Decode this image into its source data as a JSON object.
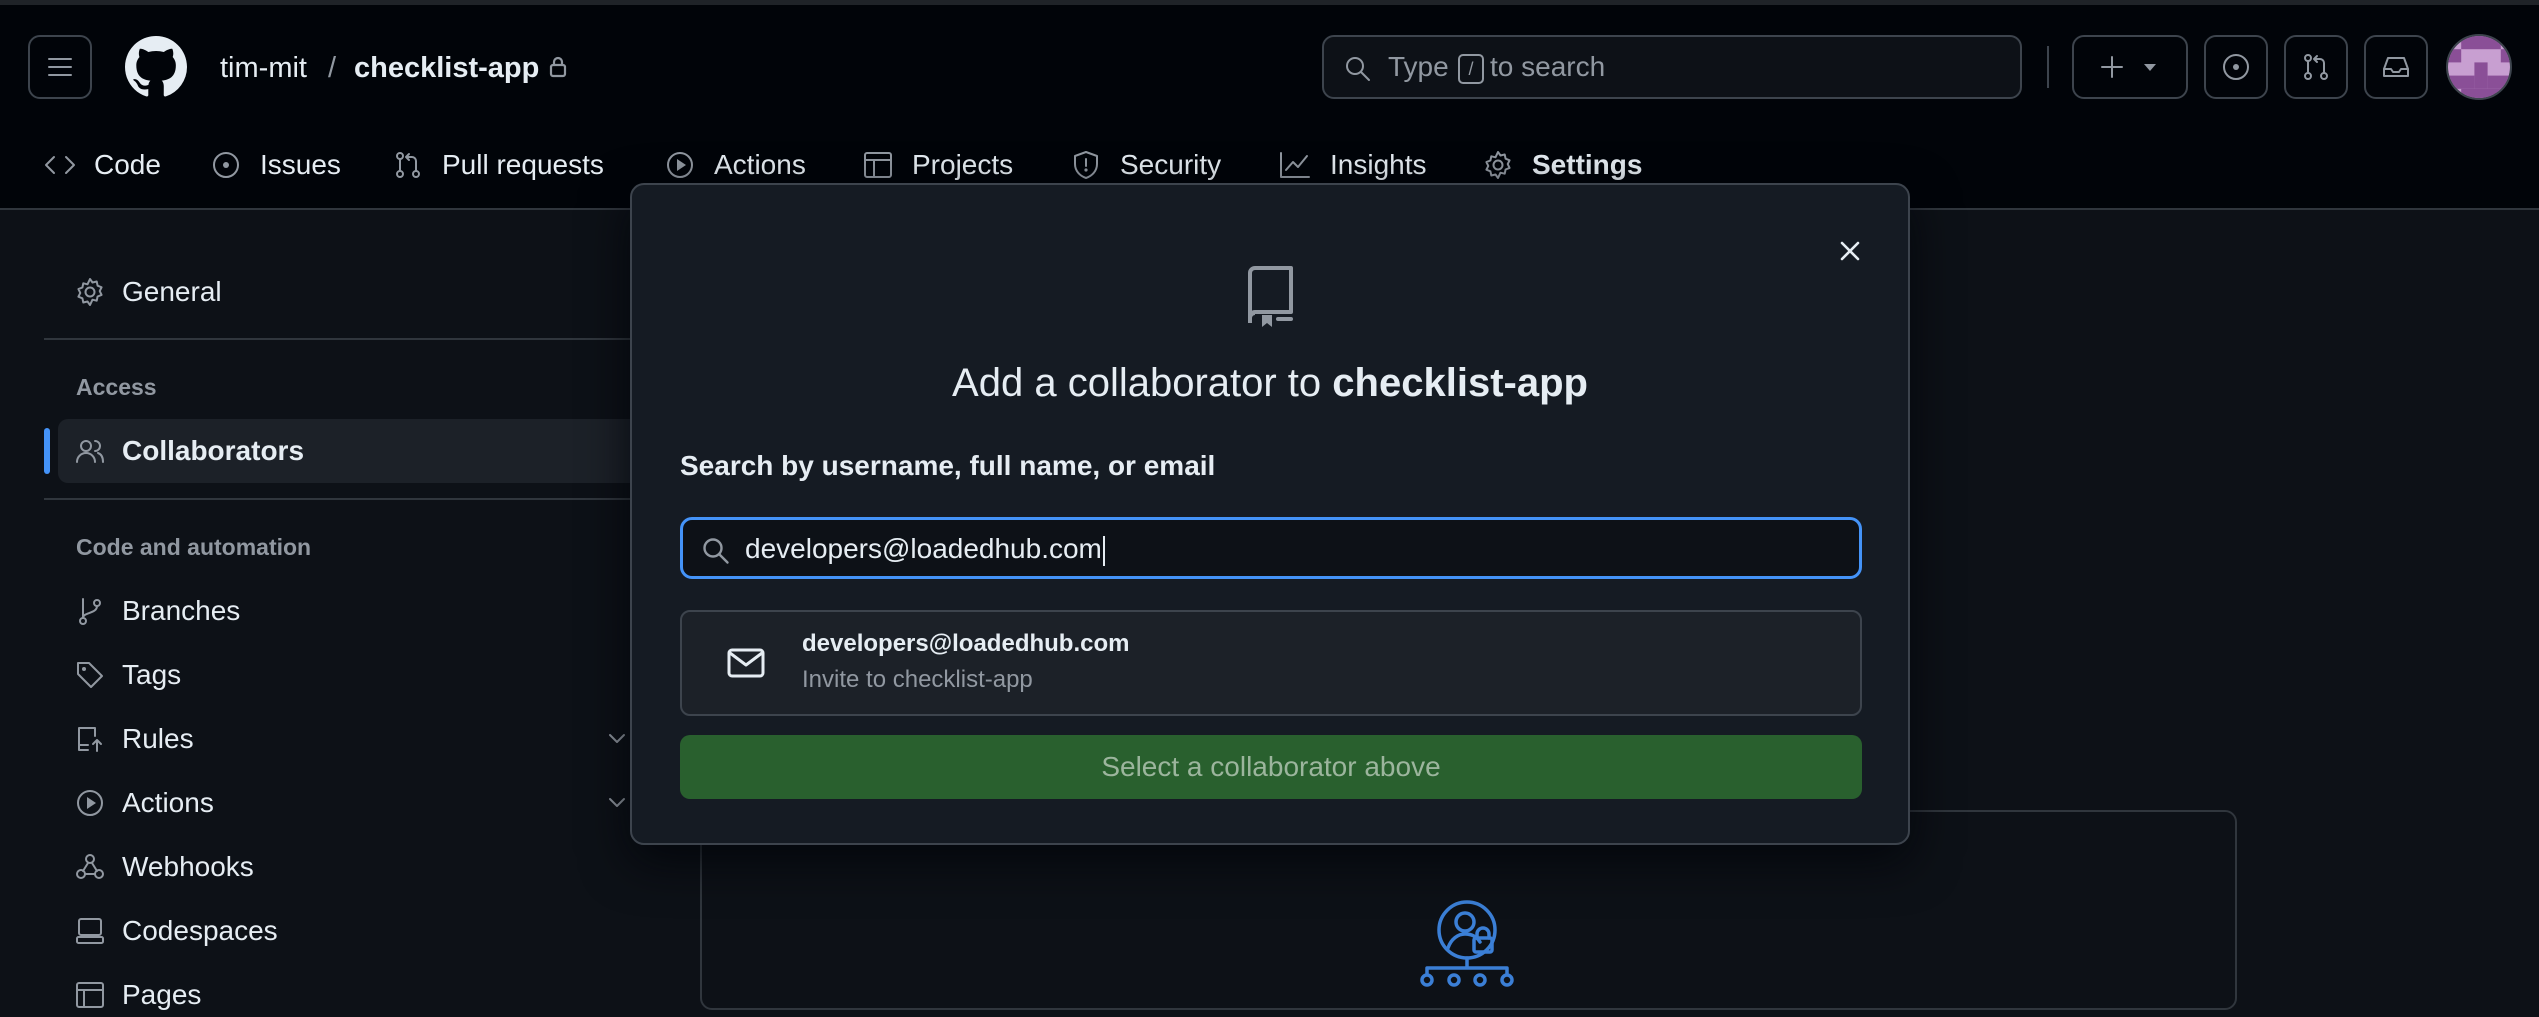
{
  "header": {
    "owner": "tim-mit",
    "separator": "/",
    "repo": "checklist-app",
    "search": {
      "prefix": "Type",
      "key": "/",
      "suffix": "to search"
    }
  },
  "repo_nav": {
    "items": [
      {
        "label": "Code",
        "icon": "code-icon"
      },
      {
        "label": "Issues",
        "icon": "issue-opened-icon"
      },
      {
        "label": "Pull requests",
        "icon": "git-pull-request-icon"
      },
      {
        "label": "Actions",
        "icon": "play-icon"
      },
      {
        "label": "Projects",
        "icon": "table-icon"
      },
      {
        "label": "Security",
        "icon": "shield-icon"
      },
      {
        "label": "Insights",
        "icon": "graph-icon"
      },
      {
        "label": "Settings",
        "icon": "gear-icon",
        "selected": true
      }
    ]
  },
  "sidebar": {
    "general": "General",
    "access_heading": "Access",
    "collaborators": "Collaborators",
    "code_heading": "Code and automation",
    "branches": "Branches",
    "tags": "Tags",
    "rules": "Rules",
    "actions": "Actions",
    "webhooks": "Webhooks",
    "codespaces": "Codespaces",
    "pages": "Pages"
  },
  "modal": {
    "title_prefix": "Add a collaborator to",
    "title_repo": "checklist-app",
    "search_label": "Search by username, full name, or email",
    "input_value": "developers@loadedhub.com",
    "suggestion": {
      "email": "developers@loadedhub.com",
      "subtitle": "Invite to checklist-app"
    },
    "submit_label": "Select a collaborator above"
  },
  "colors": {
    "accent_blue": "#4493f8",
    "button_green": "#29602e",
    "nav_underline": "#f78166"
  }
}
